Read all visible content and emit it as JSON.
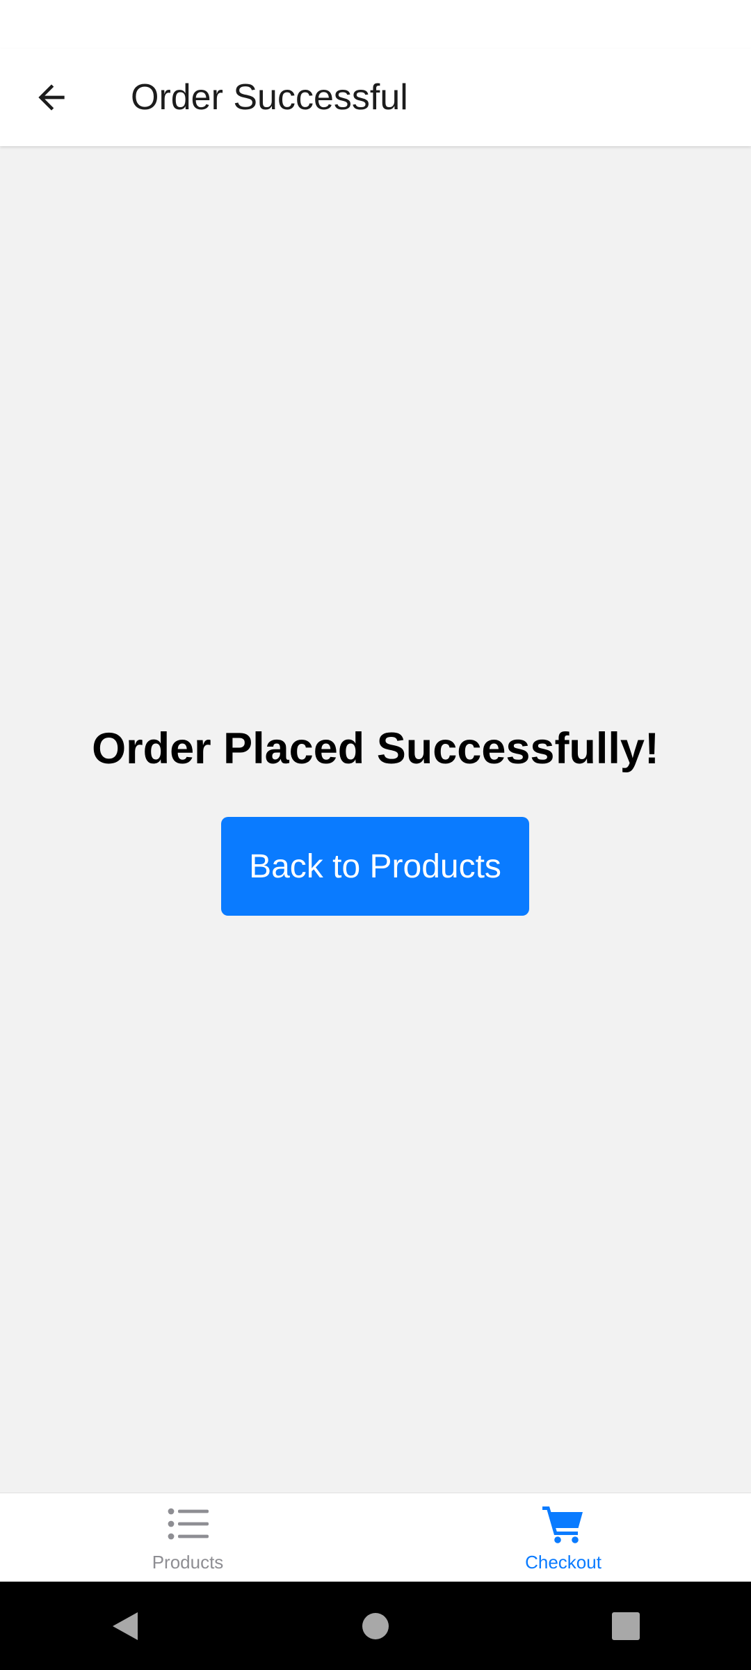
{
  "header": {
    "title": "Order Successful",
    "back_icon": "arrow-left-icon"
  },
  "main": {
    "message": "Order Placed Successfully!",
    "button_label": "Back to Products"
  },
  "tabs": [
    {
      "label": "Products",
      "icon": "list-icon",
      "active": false
    },
    {
      "label": "Checkout",
      "icon": "cart-icon",
      "active": true
    }
  ],
  "system_nav": {
    "back_icon": "nav-back-icon",
    "home_icon": "nav-home-icon",
    "recents_icon": "nav-recents-icon"
  },
  "colors": {
    "accent": "#0a7bff",
    "background": "#f2f2f2",
    "inactive_tab": "#8e8e93"
  }
}
